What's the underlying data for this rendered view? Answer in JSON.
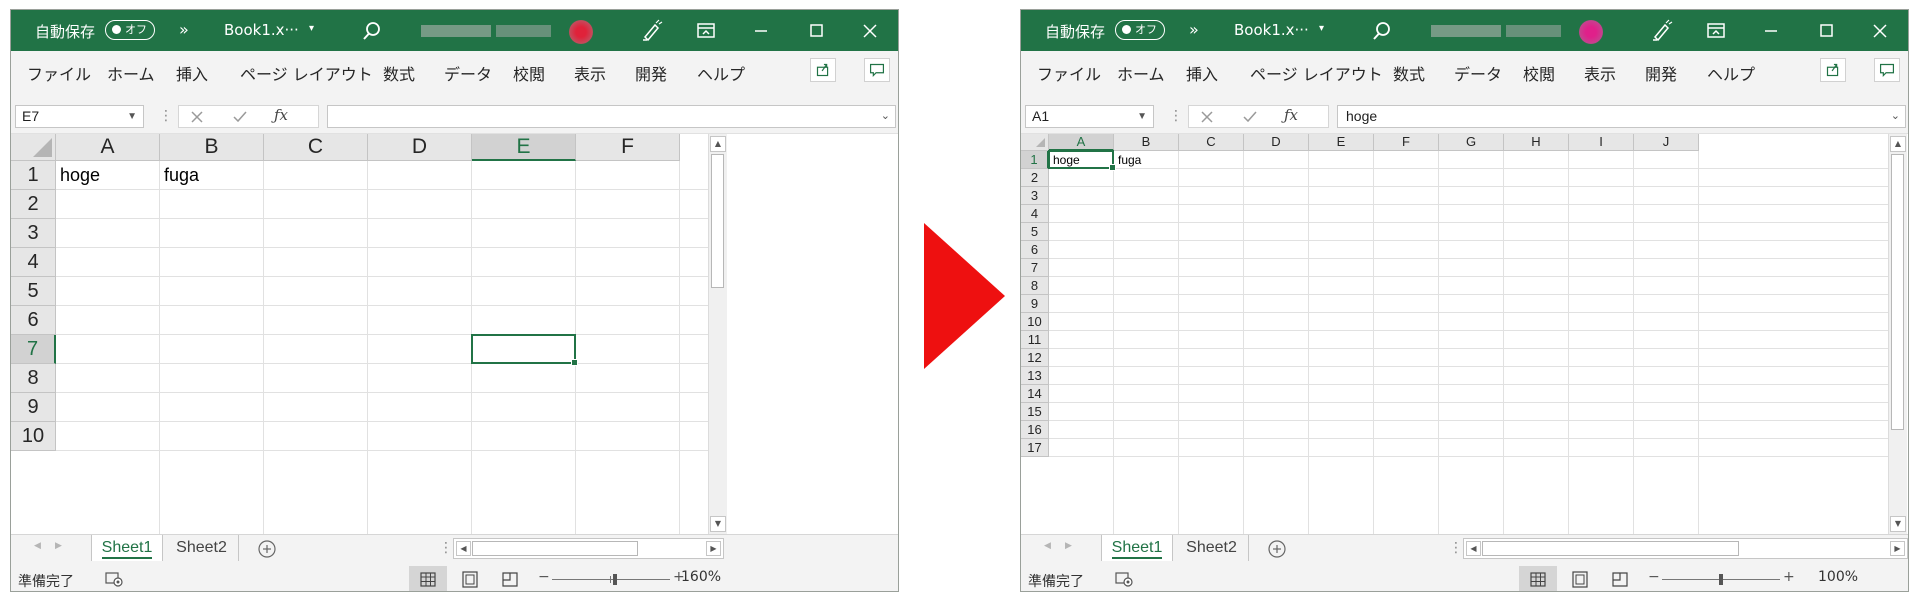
{
  "titlebar": {
    "autosave_label": "自動保存",
    "autosave_toggle": "オフ",
    "more_label": "»",
    "file_name": "Book1.x···",
    "file_menu_caret": "▾"
  },
  "ribbon": {
    "tabs": [
      "ファイル",
      "ホーム",
      "挿入",
      "ページ レイアウト",
      "数式",
      "データ",
      "校閲",
      "表示",
      "開発",
      "ヘルプ"
    ]
  },
  "before": {
    "name_box": "E7",
    "formula": "",
    "zoom": "160%",
    "columns": [
      "A",
      "B",
      "C",
      "D",
      "E",
      "F"
    ],
    "rows": [
      "1",
      "2",
      "3",
      "4",
      "5",
      "6",
      "7",
      "8",
      "9",
      "10"
    ],
    "active_column": "E",
    "active_row": "7",
    "cells": [
      {
        "ref": "A1",
        "value": "hoge"
      },
      {
        "ref": "B1",
        "value": "fuga"
      }
    ],
    "zoom_level": 1.6
  },
  "after": {
    "name_box": "A1",
    "formula": "hoge",
    "zoom": "100%",
    "columns": [
      "A",
      "B",
      "C",
      "D",
      "E",
      "F",
      "G",
      "H",
      "I",
      "J"
    ],
    "rows": [
      "1",
      "2",
      "3",
      "4",
      "5",
      "6",
      "7",
      "8",
      "9",
      "10",
      "11",
      "12",
      "13",
      "14",
      "15",
      "16",
      "17"
    ],
    "active_column": "A",
    "active_row": "1",
    "cells": [
      {
        "ref": "A1",
        "value": "hoge"
      },
      {
        "ref": "B1",
        "value": "fuga"
      }
    ],
    "zoom_level": 1.0
  },
  "sheets": [
    "Sheet1",
    "Sheet2"
  ],
  "active_sheet": "Sheet1",
  "status": {
    "ready": "準備完了"
  },
  "icons": {
    "search": "search-icon",
    "pen": "pen-icon",
    "ribbon_display": "ribbon-display-icon",
    "minimize": "minimize-icon",
    "maximize": "maximize-icon",
    "close": "close-icon",
    "share": "share-icon",
    "comment": "comment-icon",
    "cancel": "cancel-icon",
    "enter": "check-icon",
    "function": "fx-icon",
    "add_sheet": "plus-circle-icon",
    "macro": "macro-record-icon",
    "normal_view": "normal-view-icon",
    "page_layout_view": "page-layout-view-icon",
    "page_break_view": "page-break-view-icon",
    "transition": "arrow-right-icon"
  },
  "colors": {
    "excel_green": "#217346",
    "arrow_red": "#ee1010",
    "ribbon_bg": "#f3f3f3",
    "header_bg": "#e6e6e6",
    "gridline": "#e1e1e1"
  }
}
